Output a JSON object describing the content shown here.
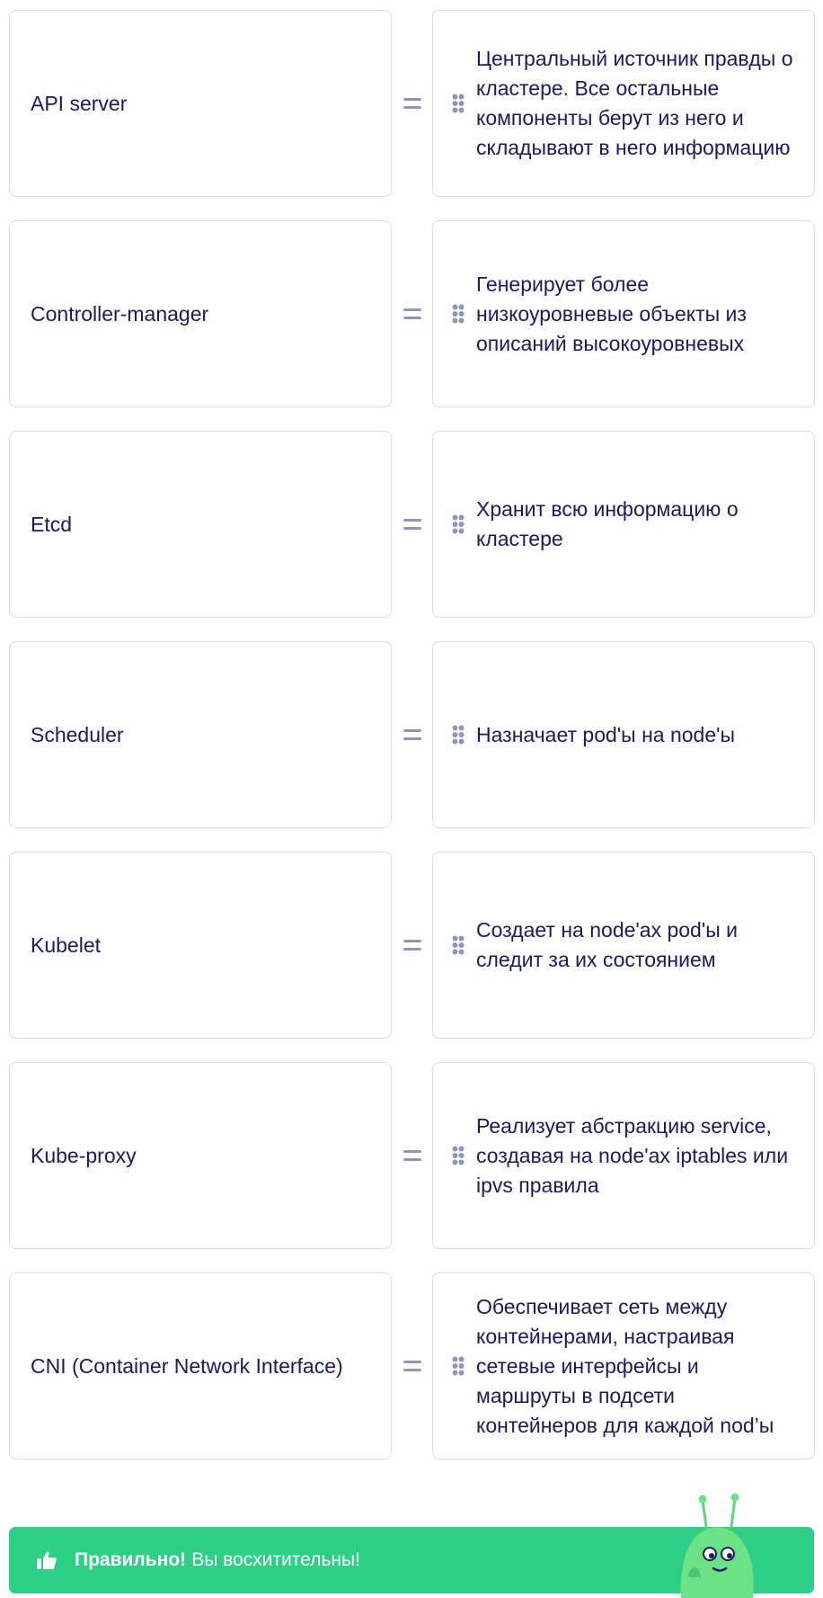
{
  "pairs": [
    {
      "term": "API server",
      "definition": "Центральный источник правды о кластере. Все остальные компоненты берут из него и складывают в него информацию"
    },
    {
      "term": "Controller-manager",
      "definition": "Генерирует более низкоуровневые объекты из описаний высокоуровневых"
    },
    {
      "term": "Etcd",
      "definition": "Хранит всю информацию о кластере"
    },
    {
      "term": "Scheduler",
      "definition": "Назначает pod'ы на node'ы"
    },
    {
      "term": "Kubelet",
      "definition": "Создает на node'ах pod'ы и следит за их состоянием"
    },
    {
      "term": "Kube-proxy",
      "definition": "Реализует абстракцию service, создавая на node'ах iptables или ipvs правила"
    },
    {
      "term": "CNI (Container Network Interface)",
      "definition": "Обеспечивает сеть между контейнерами, настраивая сетевые интерфейсы и маршруты в подсети контейнеров для каждой nod’ы"
    }
  ],
  "feedback": {
    "title": "Правильно!",
    "message": "Вы восхитительны!",
    "icon": "thumbs-up-icon",
    "color": "#2ecf86"
  },
  "colors": {
    "text": "#1a1b5e",
    "border": "#dcdde3",
    "equals": "#8d97b5",
    "grip": "#8d97b5"
  }
}
